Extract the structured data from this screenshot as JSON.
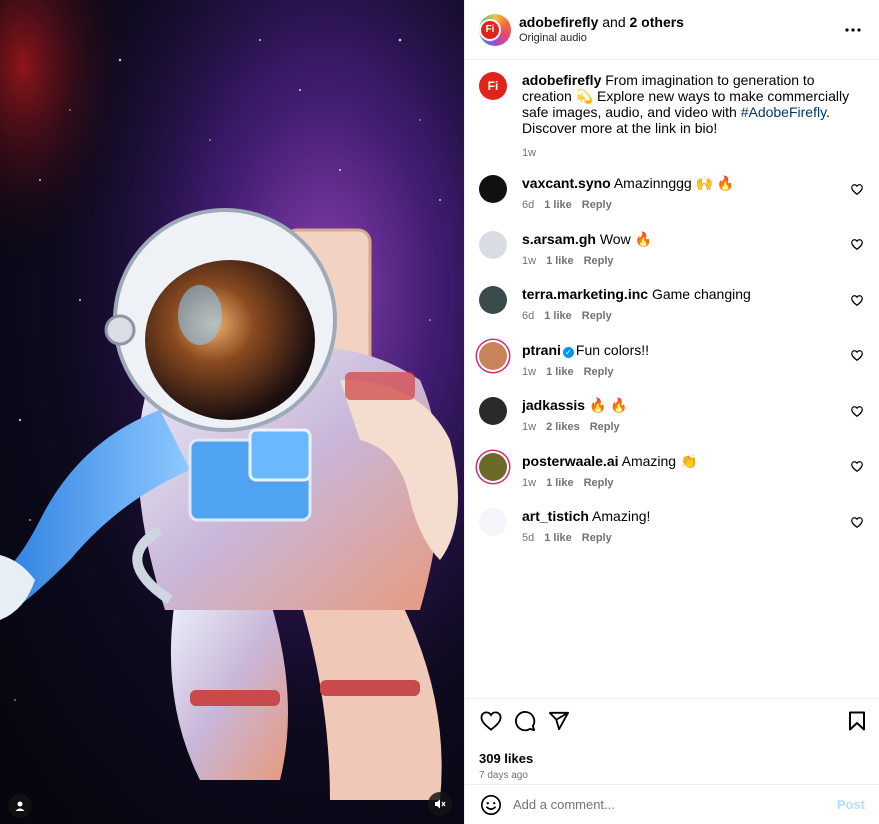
{
  "post": {
    "author": "adobefirefly",
    "coauthors_conj": " and ",
    "coauthors": "2 others",
    "audio": "Original audio",
    "avatar_initials": "Fi"
  },
  "caption": {
    "user": "adobefirefly",
    "text_before": " From imagination to generation to creation 💫 Explore new ways to make commercially safe images, audio, and video with ",
    "hashtag": "#AdobeFirefly",
    "text_after": ". Discover more at the link in bio!",
    "time": "1w"
  },
  "comments": [
    {
      "user": "vaxcant.syno",
      "text": "Amazinnggg 🙌 🔥",
      "time": "6d",
      "likes": "1 like",
      "reply": "Reply",
      "avatar_color": "#111111",
      "verified": false,
      "storied": false
    },
    {
      "user": "s.arsam.gh",
      "text": "Wow 🔥",
      "time": "1w",
      "likes": "1 like",
      "reply": "Reply",
      "avatar_color": "#d9dde3",
      "verified": false,
      "storied": false
    },
    {
      "user": "terra.marketing.inc",
      "text": "Game changing",
      "time": "6d",
      "likes": "1 like",
      "reply": "Reply",
      "avatar_color": "#3b4a4a",
      "verified": false,
      "storied": false
    },
    {
      "user": "ptrani",
      "text": "Fun colors!!",
      "time": "1w",
      "likes": "1 like",
      "reply": "Reply",
      "avatar_color": "#c7845a",
      "verified": true,
      "storied": true
    },
    {
      "user": "jadkassis",
      "text": "🔥 🔥",
      "time": "1w",
      "likes": "2 likes",
      "reply": "Reply",
      "avatar_color": "#2a2a2a",
      "verified": false,
      "storied": false
    },
    {
      "user": "posterwaale.ai",
      "text": "Amazing 👏",
      "time": "1w",
      "likes": "1 like",
      "reply": "Reply",
      "avatar_color": "#6b6a2a",
      "verified": false,
      "storied": true
    },
    {
      "user": "art_tistich",
      "text": "Amazing!",
      "time": "5d",
      "likes": "1 like",
      "reply": "Reply",
      "avatar_color": "#f4f6fa",
      "verified": false,
      "storied": false
    }
  ],
  "footer": {
    "likes": "309 likes",
    "time_ago": "7 days ago",
    "comment_placeholder": "Add a comment...",
    "post_label": "Post"
  },
  "icons": {
    "header_more": "more-horizontal-icon",
    "like": "heart-icon",
    "comment": "comment-bubble-icon",
    "share": "paper-plane-icon",
    "save": "bookmark-icon",
    "emoji": "smiley-icon",
    "media_user": "user-tag-icon",
    "media_mute": "speaker-muted-icon"
  },
  "colors": {
    "brand_red": "#e0241b",
    "link_blue": "#00376b",
    "verified_blue": "#0095f6",
    "post_disabled": "#b2dffc",
    "muted_text": "#737373"
  }
}
